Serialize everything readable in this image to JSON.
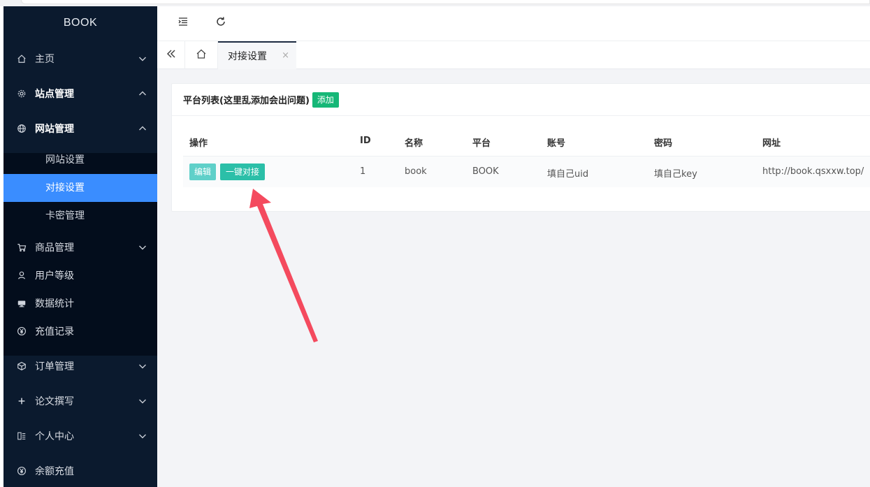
{
  "brand": "BOOK",
  "sidebar": {
    "items": [
      {
        "label": "主页",
        "icon": "home-icon"
      },
      {
        "label": "站点管理",
        "icon": "gear-icon"
      },
      {
        "label": "网站管理",
        "icon": "globe-icon"
      },
      {
        "label": "商品管理",
        "icon": "cart-icon"
      },
      {
        "label": "用户等级",
        "icon": "user-icon"
      },
      {
        "label": "数据统计",
        "icon": "stats-icon"
      },
      {
        "label": "充值记录",
        "icon": "yen-icon"
      },
      {
        "label": "订单管理",
        "icon": "box-icon"
      },
      {
        "label": "论文撰写",
        "icon": "plus-icon"
      },
      {
        "label": "个人中心",
        "icon": "profile-icon"
      },
      {
        "label": "余额充值",
        "icon": "yen-icon"
      }
    ],
    "submenu": [
      "网站设置",
      "对接设置",
      "卡密管理"
    ]
  },
  "tabs": {
    "active_label": "对接设置",
    "close": "×"
  },
  "card": {
    "title": "平台列表(这里乱添加会出问题)",
    "add_label": "添加"
  },
  "table": {
    "headers": [
      "操作",
      "ID",
      "名称",
      "平台",
      "账号",
      "密码",
      "网址"
    ],
    "rows": [
      {
        "edit_label": "编辑",
        "dock_label": "一键对接",
        "id": "1",
        "name": "book",
        "platform": "BOOK",
        "account": "填自己uid",
        "password": "填自己key",
        "url": "http://book.qsxxw.top/"
      }
    ]
  },
  "colors": {
    "sidebar_bg": "#0b1a2e",
    "active_item": "#3a8dff",
    "add_button": "#16b777",
    "annotation_arrow": "#f44a5e"
  }
}
